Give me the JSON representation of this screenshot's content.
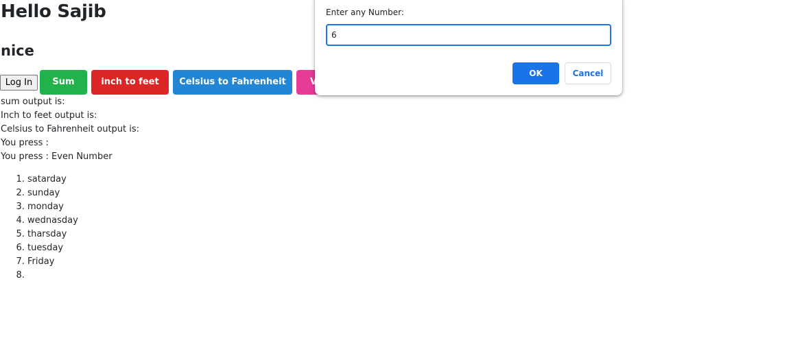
{
  "page": {
    "title": "Hello Sajib",
    "subtitle": "nice"
  },
  "buttons": {
    "login": "Log In",
    "sum": "Sum",
    "inch_to_feet": "inch to feet",
    "celsius_to_fahrenheit": "Celsius to Fahrenheit",
    "partial": "V"
  },
  "outputs": {
    "sum": "sum output is:",
    "inch": "Inch to feet output is:",
    "celsius": "Celsius to Fahrenheit output is:",
    "press": "You press :",
    "press_even": "You press : Even Number"
  },
  "days": [
    "satarday",
    "sunday",
    "monday",
    "wednasday",
    "tharsday",
    "tuesday",
    "Friday",
    ""
  ],
  "prompt_dialog": {
    "label": "Enter any Number:",
    "input_value": "6",
    "ok_label": "OK",
    "cancel_label": "Cancel"
  },
  "colors": {
    "sum_button": "#22b24c",
    "inch_button": "#dc2626",
    "celsius_button": "#2286d4",
    "partial_button": "#e63c97",
    "dialog_accent": "#1a73e8"
  }
}
